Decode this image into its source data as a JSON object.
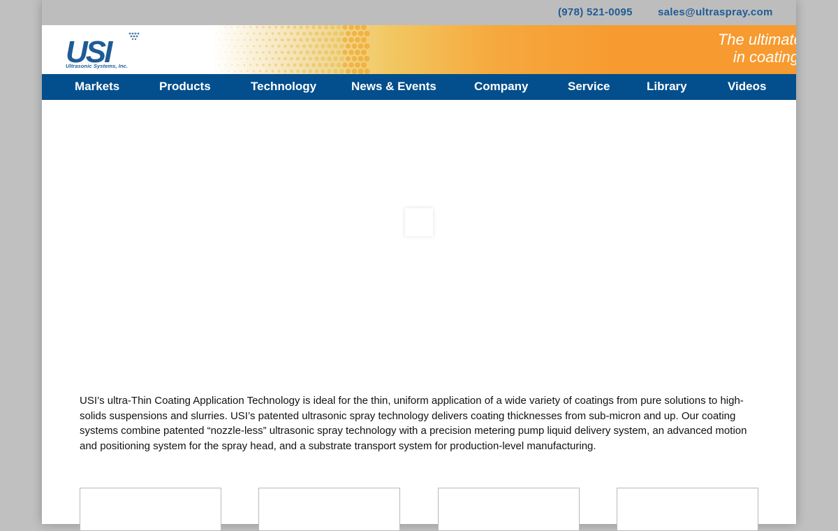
{
  "topbar": {
    "phone": "(978) 521-0095",
    "email": "sales@ultraspray.com"
  },
  "header": {
    "logo_text": "USI",
    "logo_subtitle": "Ultrasonic Systems, Inc.",
    "tagline_line1": "The ultimate c",
    "tagline_line2": "in coating",
    "brand_blue": "#1f5b95",
    "brand_orange": "#f79a2f"
  },
  "nav": {
    "items": [
      {
        "label": "Markets"
      },
      {
        "label": "Products"
      },
      {
        "label": "Technology"
      },
      {
        "label": "News & Events"
      },
      {
        "label": "Company"
      },
      {
        "label": "Service"
      },
      {
        "label": "Library"
      },
      {
        "label": "Videos"
      }
    ],
    "background": "#034f8d"
  },
  "main": {
    "intro": "USI’s ultra-Thin Coating Application Technology is ideal for the thin, uniform application of a wide variety of coatings from pure solutions to high-solids suspensions and slurries.  USI’s patented ultrasonic spray technology delivers coating thicknesses from sub-micron and up.  Our coating systems combine patented “nozzle-less” ultrasonic spray technology with a precision metering pump liquid delivery system, an advanced motion and positioning system for the spray head, and a substrate transport system for production-level manufacturing."
  }
}
